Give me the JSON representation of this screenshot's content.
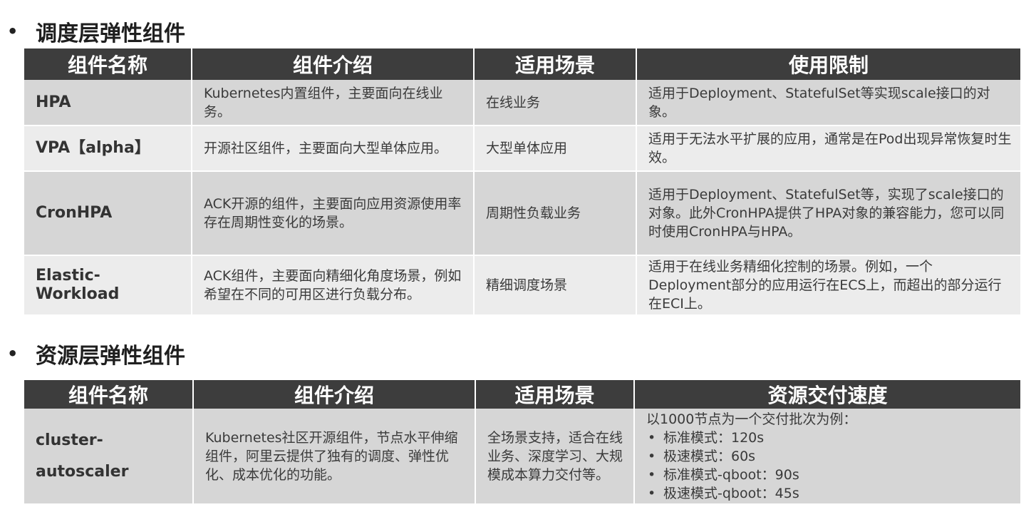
{
  "section1": {
    "title": "调度层弹性组件",
    "headers": [
      "组件名称",
      "组件介绍",
      "适用场景",
      "使用限制"
    ],
    "rows": [
      {
        "name": "HPA",
        "intro": "Kubernetes内置组件，主要面向在线业务。",
        "scenario": "在线业务",
        "limit": "适用于Deployment、StatefulSet等实现scale接口的对象。"
      },
      {
        "name": "VPA【alpha】",
        "intro": "开源社区组件，主要面向大型单体应用。",
        "scenario": "大型单体应用",
        "limit": "适用于无法水平扩展的应用，通常是在Pod出现异常恢复时生效。"
      },
      {
        "name": "CronHPA",
        "intro": "ACK开源的组件，主要面向应用资源使用率存在周期性变化的场景。",
        "scenario": "周期性负载业务",
        "limit": "适用于Deployment、StatefulSet等，实现了scale接口的对象。此外CronHPA提供了HPA对象的兼容能力，您可以同时使用CronHPA与HPA。"
      },
      {
        "name": "Elastic-Workload",
        "intro": "ACK组件，主要面向精细化角度场景，例如希望在不同的可用区进行负载分布。",
        "scenario": "精细调度场景",
        "limit": "适用于在线业务精细化控制的场景。例如，一个Deployment部分的应用运行在ECS上，而超出的部分运行在ECI上。"
      }
    ]
  },
  "section2": {
    "title": "资源层弹性组件",
    "headers": [
      "组件名称",
      "组件介绍",
      "适用场景",
      "资源交付速度"
    ],
    "row": {
      "name": "cluster-autoscaler",
      "intro": "Kubernetes社区开源组件，节点水平伸缩组件，阿里云提供了独有的调度、弹性优化、成本优化的功能。",
      "scenario": "全场景支持，适合在线业务、深度学习、大规模成本算力交付等。",
      "speed_intro": "以1000节点为一个交付批次为例：",
      "speed_items": [
        "标准模式：120s",
        "极速模式：60s",
        "标准模式-qboot：90s",
        "极速模式-qboot：45s"
      ]
    }
  },
  "colors": {
    "header_bg": "#3d3d3d",
    "row_dark": "#d6d6d6",
    "row_light": "#ececec"
  }
}
